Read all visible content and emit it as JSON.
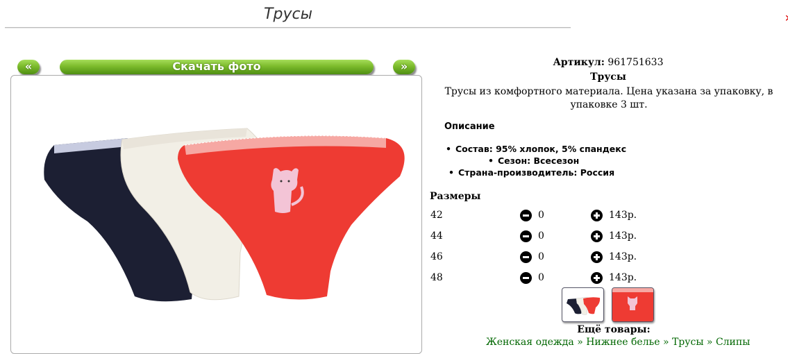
{
  "page": {
    "title": "Трусы"
  },
  "gallery": {
    "prev_label": "«",
    "download_label": "Скачать фото",
    "next_label": "»"
  },
  "product": {
    "article_label": "Артикул:",
    "article_value": "961751633",
    "name": "Трусы",
    "description": "Трусы из комфортного материала. Цена указана за упаковку, в упаковке 3 шт.",
    "desc_heading": "Описание",
    "properties": [
      "Состав: 95% хлопок, 5% спандекс",
      "Сезон: Всесезон",
      "Страна-производитель: Россия"
    ]
  },
  "sizes": {
    "heading": "Размеры",
    "rows": [
      {
        "size": "42",
        "qty": "0",
        "price": "143р."
      },
      {
        "size": "44",
        "qty": "0",
        "price": "143р."
      },
      {
        "size": "46",
        "qty": "0",
        "price": "143р."
      },
      {
        "size": "48",
        "qty": "0",
        "price": "143р."
      }
    ]
  },
  "more": {
    "heading": "Ещё товары:",
    "breadcrumb": "Женская одежда » Нижнее белье » Трусы » Слипы"
  },
  "colors": {
    "accent_green": "#7cbb2c",
    "link_green": "#006600",
    "garment_red": "#ee3b33",
    "garment_navy": "#1c1f33",
    "garment_cream": "#f2efe6"
  }
}
